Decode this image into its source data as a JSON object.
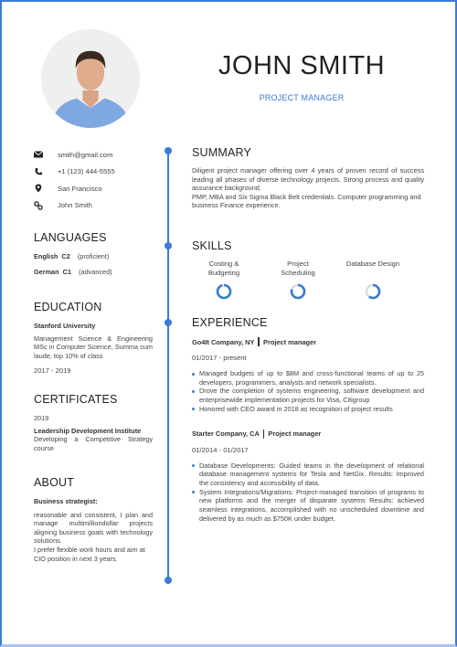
{
  "header": {
    "name": "JOHN SMITH",
    "title": "PROJECT MANAGER",
    "photo_alt": "profile-photo"
  },
  "colors": {
    "accent": "#3a7bd5",
    "text": "#333333",
    "ring_track": "#dddddd"
  },
  "contact": [
    {
      "icon": "envelope-icon",
      "value": "smith@gmail.com"
    },
    {
      "icon": "phone-icon",
      "value": "+1 (123) 444-5555"
    },
    {
      "icon": "location-pin-icon",
      "value": "San Francisco"
    },
    {
      "icon": "link-icon",
      "value": "John Smith"
    }
  ],
  "languages": {
    "heading": "LANGUAGES",
    "items": [
      {
        "language": "English",
        "level": "C2",
        "note": "(proficient)"
      },
      {
        "language": "German",
        "level": "C1",
        "note": "(advanced)"
      }
    ]
  },
  "education": {
    "heading": "EDUCATION",
    "school": "Stanford University",
    "description": "Management Science & Engineering MSc in Computer Science, Summa cum laude, top 10% of class",
    "years": "2017 - 2019"
  },
  "certificates": {
    "heading": "CERTIFICATES",
    "year": "2019",
    "institution": "Leadership Development Institute",
    "course": "Developing a Competitive Strategy course"
  },
  "about": {
    "heading": "ABOUT",
    "subheading": "Business strategist:",
    "text1": "reasonable and consistent, I plan and manage multimilliondollar projects aligning business goals with technology solutions.",
    "text2": "I prefer flexible work hours and aim at CIO position in next 3 years."
  },
  "summary": {
    "heading": "SUMMARY",
    "text1": "Diligent project manager offering over 4 years of proven record of success leading all phases of diverse technology projects. Strong process and quality assurance background.",
    "text2": "PMP, MBA and Six Sigma Black Belt credentials. Computer programming and business Finance experience."
  },
  "skills": {
    "heading": "SKILLS",
    "items": [
      {
        "label_line1": "Costing &",
        "label_line2": "Budgeting",
        "level": 0.95
      },
      {
        "label_line1": "Project",
        "label_line2": "Scheduling",
        "level": 0.8
      },
      {
        "label_line1": "Database Design",
        "label_line2": "",
        "level": 0.6
      }
    ]
  },
  "experience": {
    "heading": "EXPERIENCE",
    "jobs": [
      {
        "company": "Go4It Company, NY",
        "role": "Project manager",
        "dates": "01/2017 - present",
        "bullets": [
          "Managed budgets of up to $8M and cross-functional teams of up to 25 developers, programmers, analysts and network specialists.",
          "Drove the completion of systems engineering, software development and enterprisewide implementation projects for Visa, Citigroup",
          "Honored with CEO award in 2018 as recognition of project results"
        ]
      },
      {
        "company": "Starter Company, CA",
        "role": "Project manager",
        "dates": "01/2014 - 01/2017",
        "bullets": [
          "Database Developments: Guided teams in the development of relational database management systems for Tesla and NetGix. Results: Improved the consistency and accessibility of data.",
          "System Integrations/Migrations: Project-managed transition of programs to new platforms and the merger of disparate systems Results: achieved seamless integrations, accomplished with no unscheduled downtime and delivered by as much as $750K under budget."
        ]
      }
    ]
  }
}
